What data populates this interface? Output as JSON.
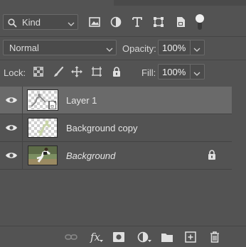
{
  "filter": {
    "kind_label": "Kind",
    "icons": [
      "image-filter-icon",
      "adjustment-filter-icon",
      "type-filter-icon",
      "shape-filter-icon",
      "smart-object-filter-icon",
      "filter-toggle"
    ]
  },
  "blend": {
    "mode_label": "Normal",
    "opacity_label": "Opacity:",
    "opacity_value": "100%"
  },
  "lock": {
    "label": "Lock:",
    "fill_label": "Fill:",
    "fill_value": "100%",
    "icons": [
      "lock-transparent-pixels-icon",
      "lock-image-pixels-icon",
      "lock-position-icon",
      "lock-artboard-icon",
      "lock-all-icon"
    ]
  },
  "layers": [
    {
      "name": "Layer 1",
      "selected": true,
      "italic": false,
      "locked": false
    },
    {
      "name": "Background copy",
      "selected": false,
      "italic": false,
      "locked": false
    },
    {
      "name": "Background",
      "selected": false,
      "italic": true,
      "locked": true
    }
  ],
  "bottom_bar": {
    "icons": [
      "link-layers-icon",
      "add-layer-style-icon",
      "add-mask-icon",
      "new-adjustment-layer-icon",
      "new-group-icon",
      "new-layer-icon",
      "delete-layer-icon"
    ],
    "fx_label": "fx"
  },
  "colors": {
    "panel_bg": "#535353",
    "selected_row": "#6a6a6a",
    "text": "#d6d6d6"
  }
}
